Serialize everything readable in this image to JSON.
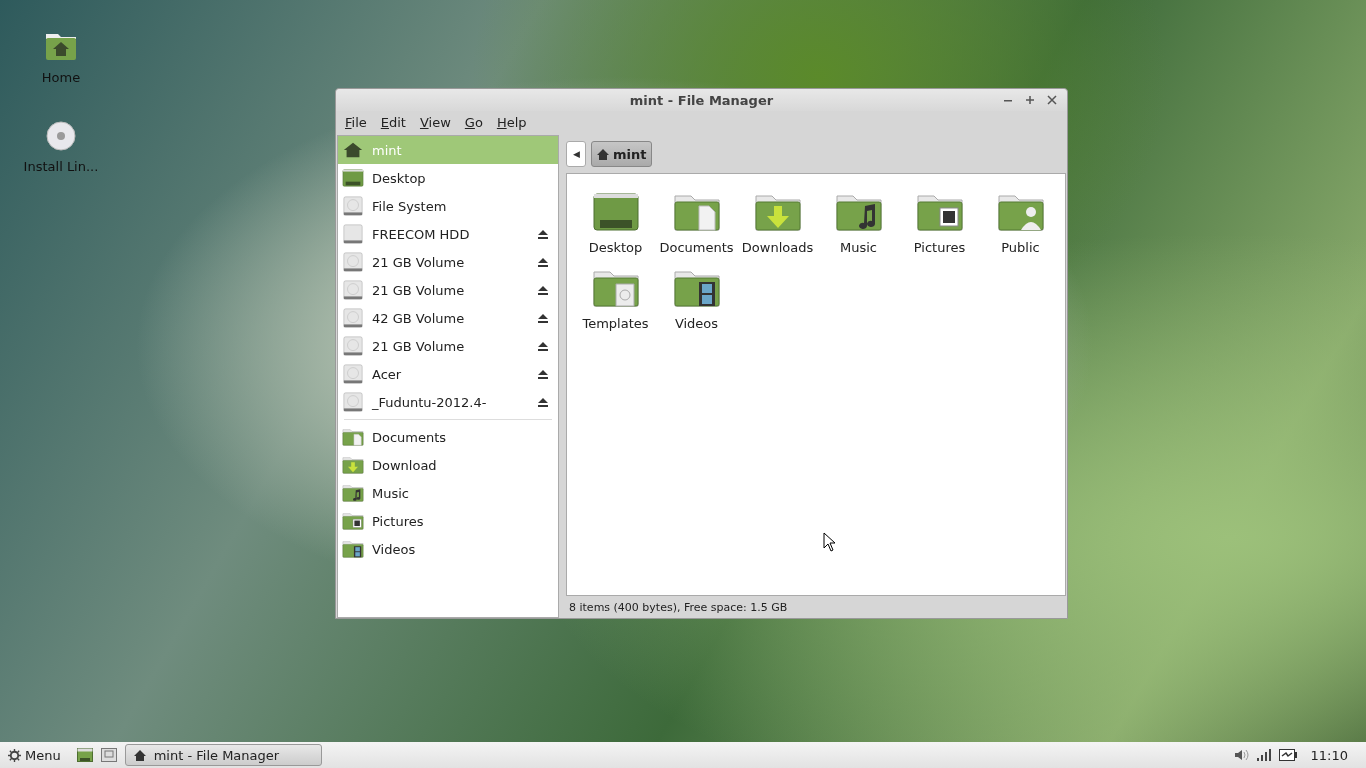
{
  "desktop_icons": [
    {
      "label": "Home",
      "kind": "home-folder"
    },
    {
      "label": "Install Lin...",
      "kind": "disc"
    }
  ],
  "window": {
    "title": "mint - File Manager"
  },
  "menu": [
    "File",
    "Edit",
    "View",
    "Go",
    "Help"
  ],
  "sidebar": {
    "devices": [
      {
        "label": "mint",
        "kind": "home",
        "selected": true,
        "ejectable": false
      },
      {
        "label": "Desktop",
        "kind": "desktop",
        "selected": false,
        "ejectable": false
      },
      {
        "label": "File System",
        "kind": "disk",
        "selected": false,
        "ejectable": false
      },
      {
        "label": "FREECOM HDD",
        "kind": "removable",
        "selected": false,
        "ejectable": true
      },
      {
        "label": "21 GB Volume",
        "kind": "disk",
        "selected": false,
        "ejectable": true
      },
      {
        "label": "21 GB Volume",
        "kind": "disk",
        "selected": false,
        "ejectable": true
      },
      {
        "label": "42 GB Volume",
        "kind": "disk",
        "selected": false,
        "ejectable": true
      },
      {
        "label": "21 GB Volume",
        "kind": "disk",
        "selected": false,
        "ejectable": true
      },
      {
        "label": "Acer",
        "kind": "disk",
        "selected": false,
        "ejectable": true
      },
      {
        "label": "_Fuduntu-2012.4-",
        "kind": "disk",
        "selected": false,
        "ejectable": true
      }
    ],
    "bookmarks": [
      {
        "label": "Documents",
        "kind": "documents",
        "selected": false
      },
      {
        "label": "Download",
        "kind": "downloads",
        "selected": false
      },
      {
        "label": "Music",
        "kind": "music",
        "selected": false
      },
      {
        "label": "Pictures",
        "kind": "pictures",
        "selected": false
      },
      {
        "label": "Videos",
        "kind": "videos",
        "selected": false
      }
    ]
  },
  "path_bar": {
    "back": "◀",
    "crumb": "mint"
  },
  "files": [
    {
      "label": "Desktop",
      "kind": "desktop"
    },
    {
      "label": "Documents",
      "kind": "documents"
    },
    {
      "label": "Downloads",
      "kind": "downloads"
    },
    {
      "label": "Music",
      "kind": "music"
    },
    {
      "label": "Pictures",
      "kind": "pictures"
    },
    {
      "label": "Public",
      "kind": "public"
    },
    {
      "label": "Templates",
      "kind": "templates"
    },
    {
      "label": "Videos",
      "kind": "videos"
    }
  ],
  "status_bar": "8 items (400 bytes), Free space: 1.5 GB",
  "taskbar": {
    "menu": "Menu",
    "task": "mint - File Manager",
    "clock": "11:10"
  }
}
